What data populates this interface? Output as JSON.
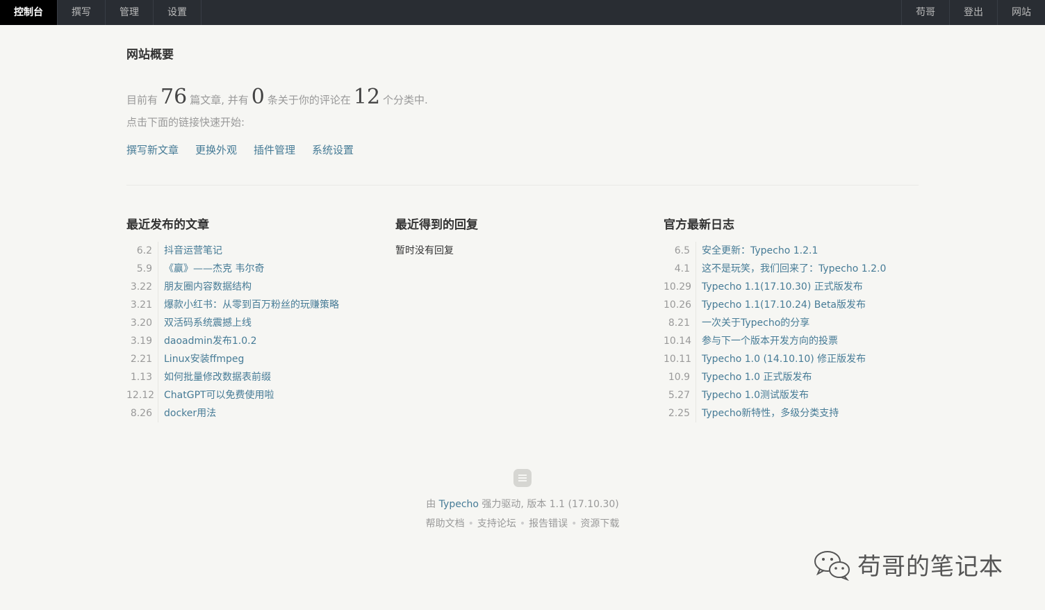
{
  "nav": {
    "left": [
      "控制台",
      "撰写",
      "管理",
      "设置"
    ],
    "right": [
      "苟哥",
      "登出",
      "网站"
    ]
  },
  "page": {
    "title": "网站概要",
    "stats": {
      "prefix": "目前有",
      "posts": "76",
      "posts_text": "篇文章, 并有",
      "comments": "0",
      "comments_text": "条关于你的评论在",
      "categories": "12",
      "categories_text": "个分类中."
    },
    "quick_hint": "点击下面的链接快速开始:",
    "quick_links": [
      "撰写新文章",
      "更换外观",
      "插件管理",
      "系统设置"
    ]
  },
  "recent_posts": {
    "title": "最近发布的文章",
    "items": [
      {
        "date": "6.2",
        "title": "抖音运营笔记"
      },
      {
        "date": "5.9",
        "title": "《赢》——杰克 韦尔奇"
      },
      {
        "date": "3.22",
        "title": "朋友圈内容数据结构"
      },
      {
        "date": "3.21",
        "title": "爆款小红书：从零到百万粉丝的玩赚策略"
      },
      {
        "date": "3.20",
        "title": "双活码系统震撼上线"
      },
      {
        "date": "3.19",
        "title": "daoadmin发布1.0.2"
      },
      {
        "date": "2.21",
        "title": "Linux安装ffmpeg"
      },
      {
        "date": "1.13",
        "title": "如何批量修改数据表前缀"
      },
      {
        "date": "12.12",
        "title": "ChatGPT可以免费使用啦"
      },
      {
        "date": "8.26",
        "title": "docker用法"
      }
    ]
  },
  "recent_replies": {
    "title": "最近得到的回复",
    "empty": "暂时没有回复"
  },
  "official_news": {
    "title": "官方最新日志",
    "items": [
      {
        "date": "6.5",
        "title": "安全更新：Typecho 1.2.1"
      },
      {
        "date": "4.1",
        "title": "这不是玩笑，我们回来了：Typecho 1.2.0"
      },
      {
        "date": "10.29",
        "title": "Typecho 1.1(17.10.30) 正式版发布"
      },
      {
        "date": "10.26",
        "title": "Typecho 1.1(17.10.24) Beta版发布"
      },
      {
        "date": "8.21",
        "title": "一次关于Typecho的分享"
      },
      {
        "date": "10.14",
        "title": "参与下一个版本开发方向的投票"
      },
      {
        "date": "10.11",
        "title": "Typecho 1.0 (14.10.10) 修正版发布"
      },
      {
        "date": "10.9",
        "title": "Typecho 1.0 正式版发布"
      },
      {
        "date": "5.27",
        "title": "Typecho 1.0测试版发布"
      },
      {
        "date": "2.25",
        "title": "Typecho新特性，多级分类支持"
      }
    ]
  },
  "footer": {
    "powered_prefix": "由",
    "powered_link": "Typecho",
    "powered_suffix": "强力驱动, 版本 1.1 (17.10.30)",
    "links": [
      "帮助文档",
      "支持论坛",
      "报告错误",
      "资源下载"
    ],
    "separator": "•"
  },
  "watermark": {
    "text": "苟哥的笔记本",
    "icon": "wechat-icon"
  },
  "colors": {
    "topbar": "#292d33",
    "link": "#467b96",
    "background": "#f6f6f3"
  }
}
